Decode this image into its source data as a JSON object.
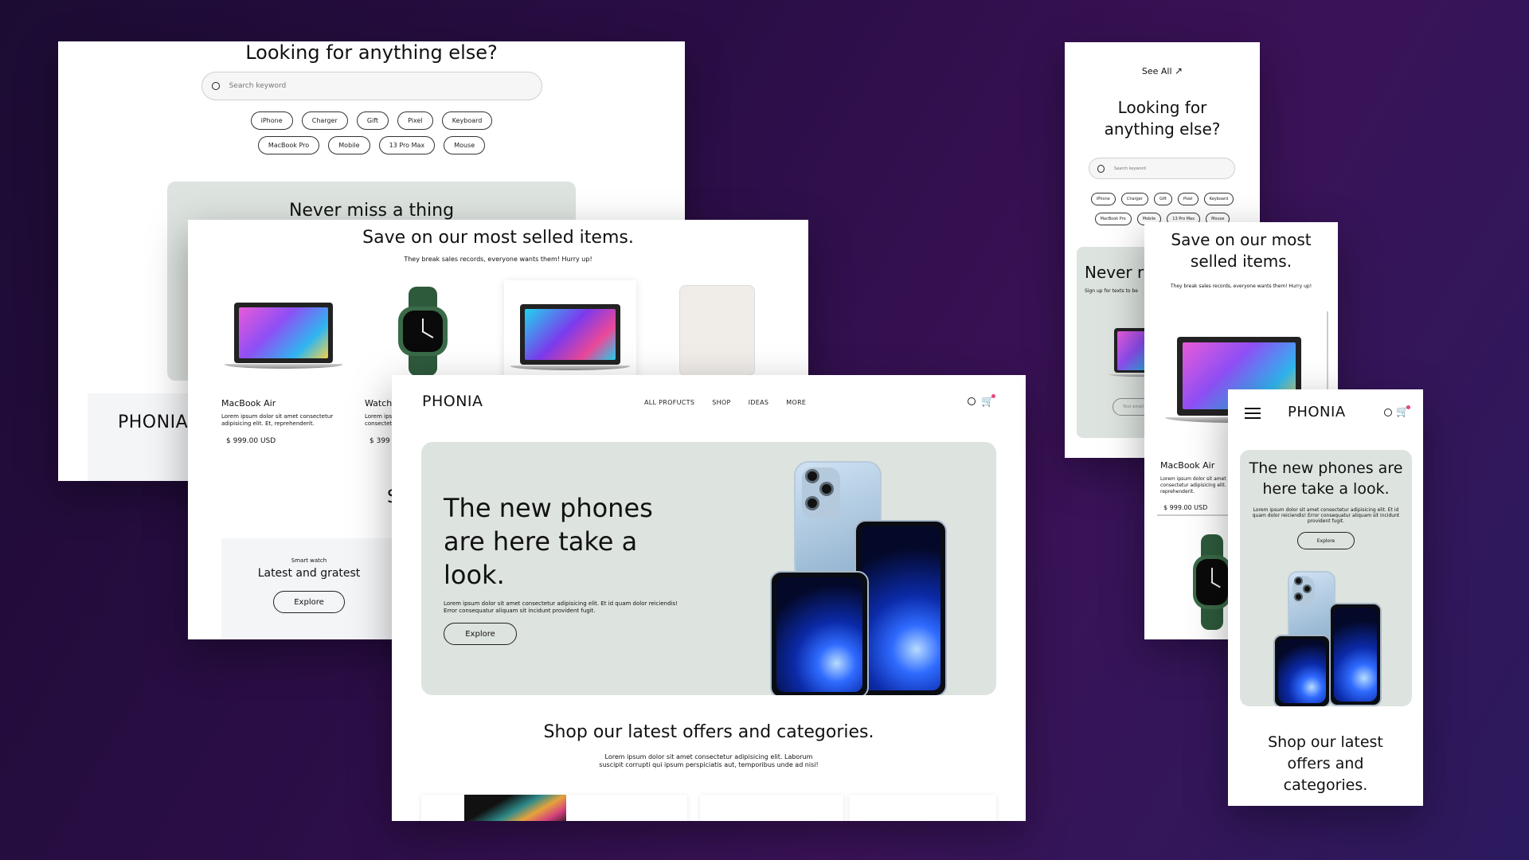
{
  "search_panel": {
    "heading": "Looking for anything else?",
    "search_placeholder": "Search keyword",
    "tags_row1": [
      "iPhone",
      "Charger",
      "Gift",
      "Pixel",
      "Keyboard"
    ],
    "tags_row2": [
      "MacBook Pro",
      "Mobile",
      "13 Pro Max",
      "Mouse"
    ],
    "newsletter_heading": "Never miss a thing",
    "footer_logo": "PHONIA"
  },
  "bestsellers_panel": {
    "heading": "Save on our most selled items.",
    "subheading": "They break sales records, everyone wants them! Hurry up!",
    "products": [
      {
        "name": "MacBook Air",
        "desc": "Lorem ipsum dolor sit amet consectetur adipisicing elit. Et, reprehenderit.",
        "price": "$ 999.00 USD"
      },
      {
        "name": "Watch",
        "desc": "Lorem ipsum dolor sit amet consectetur adipisicing elit.",
        "price": "$ 399"
      }
    ],
    "promo_eyebrow": "Smart watch",
    "promo_title": "Latest and gratest",
    "promo_button": "Explore",
    "partial_letter": "S"
  },
  "desktop_home": {
    "logo": "PHONIA",
    "nav": [
      "ALL PROFUCTS",
      "SHOP",
      "IDEAS",
      "MORE"
    ],
    "hero_title": "The new phones are here take a look.",
    "hero_body": "Lorem ipsum dolor sit amet consectetur adipisicing elit. Et id quam dolor reiciendis! Error consequatur aliquam sit incidunt provident fugit.",
    "hero_button": "Explore",
    "offers_title": "Shop our latest offers and categories.",
    "offers_body": "Lorem ipsum dolor sit amet consectetur adipisicing elit. Laborum suscipit corrupti qui ipsum perspiciatis aut, temporibus unde ad nisi!"
  },
  "tablet_search": {
    "see_all": "See All",
    "heading": "Looking for anything else?",
    "search_placeholder": "Search keyword",
    "tags_row1": [
      "iPhone",
      "Charger",
      "Gift",
      "Pixel",
      "Keyboard"
    ],
    "tags_row2": [
      "MacBook Pro",
      "Mobile",
      "13 Pro Max",
      "Mouse"
    ],
    "newsletter_heading": "Never r",
    "newsletter_sub": "Sign up for texts to be",
    "email_placeholder": "Your email"
  },
  "tablet_bestsellers": {
    "heading": "Save on our most selled items.",
    "subheading": "They break sales records, everyone wants them! Hurry up!",
    "product_name": "MacBook Air",
    "product_desc": "Lorem ipsum dolor sit amet consectetur adipisicing elit. Et, reprehenderit.",
    "product_price": "$ 999.00 USD"
  },
  "mobile_home": {
    "logo": "PHONIA",
    "hero_title": "The new phones are here take a look.",
    "hero_body": "Lorem ipsum dolor sit amet consectetur adipisicing elit. Et id quam dolor reiciendis! Error consequatur aliquam sit incidunt provident fugit.",
    "hero_button": "Explore",
    "offers_title": "Shop our latest offers and categories."
  },
  "colors": {
    "background": "#2a0d45",
    "hero_bg": "#dde3df",
    "cart_badge": "#e8457c"
  }
}
